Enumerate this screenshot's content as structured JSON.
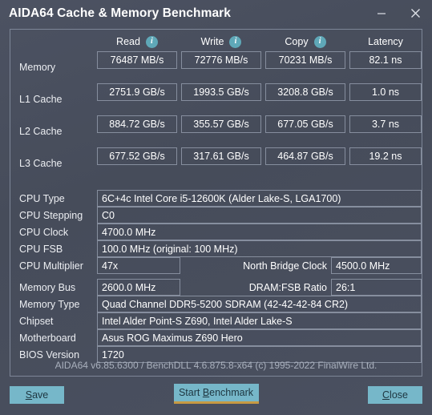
{
  "window": {
    "title": "AIDA64 Cache & Memory Benchmark",
    "minimize_icon": "minimize-icon",
    "close_icon": "close-icon"
  },
  "colors": {
    "window_bg": "#4a5060",
    "panel_border": "#7d8697",
    "accent_button": "#76b7c9",
    "focus_underline": "#c79a43",
    "info_icon": "#5fa8b8"
  },
  "benchmark": {
    "columns": [
      {
        "label": "Read",
        "info_icon": "info-icon"
      },
      {
        "label": "Write",
        "info_icon": "info-icon"
      },
      {
        "label": "Copy",
        "info_icon": "info-icon"
      },
      {
        "label": "Latency",
        "info_icon": null
      }
    ],
    "rows": [
      {
        "label": "Memory",
        "read": "76487 MB/s",
        "write": "72776 MB/s",
        "copy": "70231 MB/s",
        "latency": "82.1 ns"
      },
      {
        "label": "L1 Cache",
        "read": "2751.9 GB/s",
        "write": "1993.5 GB/s",
        "copy": "3208.8 GB/s",
        "latency": "1.0 ns"
      },
      {
        "label": "L2 Cache",
        "read": "884.72 GB/s",
        "write": "355.57 GB/s",
        "copy": "677.05 GB/s",
        "latency": "3.7 ns"
      },
      {
        "label": "L3 Cache",
        "read": "677.52 GB/s",
        "write": "317.61 GB/s",
        "copy": "464.87 GB/s",
        "latency": "19.2 ns"
      }
    ]
  },
  "cpu_info": [
    {
      "label": "CPU Type",
      "value": "6C+4c Intel Core i5-12600K  (Alder Lake-S, LGA1700)"
    },
    {
      "label": "CPU Stepping",
      "value": "C0"
    },
    {
      "label": "CPU Clock",
      "value": "4700.0 MHz"
    },
    {
      "label": "CPU FSB",
      "value": "100.0 MHz  (original: 100 MHz)"
    }
  ],
  "cpu_multiplier": {
    "label": "CPU Multiplier",
    "value": "47x",
    "secondary_label": "North Bridge Clock",
    "secondary_value": "4500.0 MHz"
  },
  "memory_bus": {
    "label": "Memory Bus",
    "value": "2600.0 MHz",
    "secondary_label": "DRAM:FSB Ratio",
    "secondary_value": "26:1"
  },
  "memory_info": [
    {
      "label": "Memory Type",
      "value": "Quad Channel DDR5-5200 SDRAM  (42-42-42-84 CR2)"
    },
    {
      "label": "Chipset",
      "value": "Intel Alder Point-S Z690, Intel Alder Lake-S"
    },
    {
      "label": "Motherboard",
      "value": "Asus ROG Maximus Z690 Hero"
    },
    {
      "label": "BIOS Version",
      "value": "1720"
    }
  ],
  "version_text": "AIDA64 v6.85.6300 / BenchDLL 4.6.875.8-x64  (c) 1995-2022 FinalWire Ltd.",
  "buttons": {
    "save": {
      "prefix": "",
      "accel": "S",
      "suffix": "ave"
    },
    "start": {
      "prefix": "Start ",
      "accel": "B",
      "suffix": "enchmark"
    },
    "close": {
      "prefix": "",
      "accel": "C",
      "suffix": "lose"
    }
  }
}
